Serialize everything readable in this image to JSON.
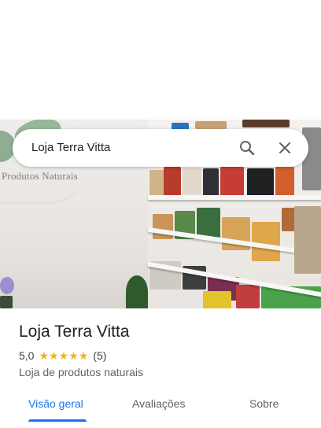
{
  "search": {
    "query": "Loja Terra Vitta"
  },
  "photo": {
    "logo_subtitle": "Produtos Naturais"
  },
  "place": {
    "name": "Loja Terra Vitta",
    "rating": "5,0",
    "stars": 5,
    "review_count": "(5)",
    "category": "Loja de produtos naturais"
  },
  "tabs": [
    {
      "label": "Visão geral",
      "active": true
    },
    {
      "label": "Avaliações",
      "active": false
    },
    {
      "label": "Sobre",
      "active": false
    }
  ],
  "colors": {
    "accent": "#1a73e8",
    "star": "#f5b50a",
    "text": "#202124",
    "secondary": "#5f6368"
  }
}
